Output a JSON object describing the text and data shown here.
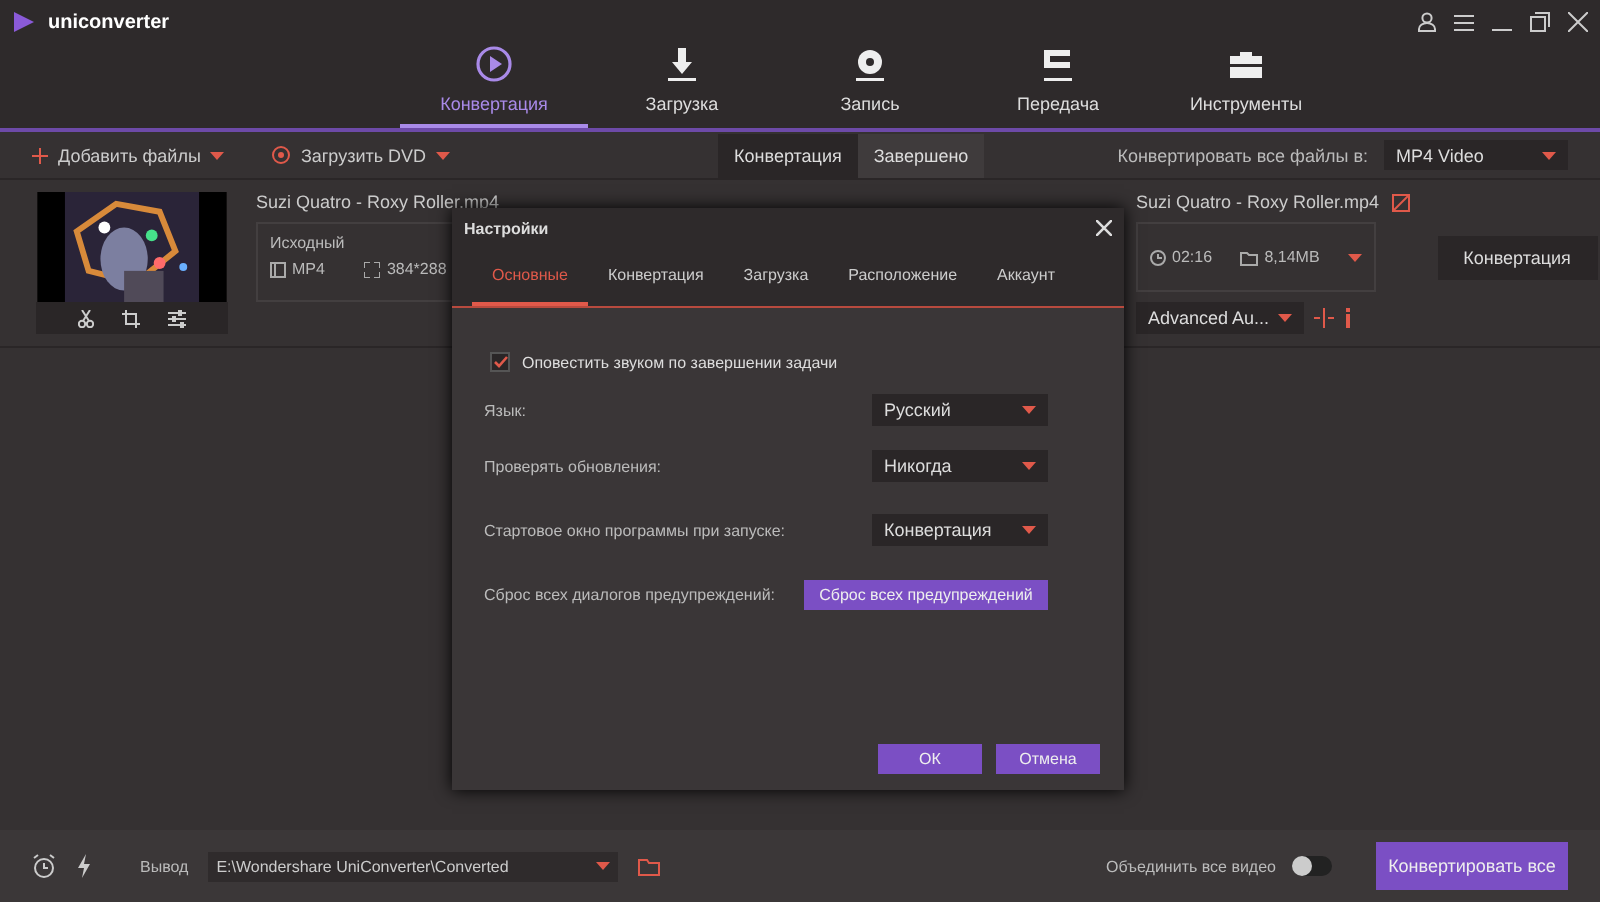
{
  "app": {
    "name": "uniconverter"
  },
  "nav": {
    "tabs": [
      {
        "label": "Конвертация",
        "selected": true
      },
      {
        "label": "Загрузка",
        "selected": false
      },
      {
        "label": "Запись",
        "selected": false
      },
      {
        "label": "Передача",
        "selected": false
      },
      {
        "label": "Инструменты",
        "selected": false
      }
    ]
  },
  "toolbar": {
    "add_files": "Добавить файлы",
    "load_dvd": "Загрузить DVD",
    "status_tabs": [
      {
        "label": "Конвертация",
        "selected": true
      },
      {
        "label": "Завершено",
        "selected": false
      }
    ],
    "convert_all_label": "Конвертировать все файлы в:",
    "format": "MP4 Video"
  },
  "file": {
    "source_title": "Suzi Quatro - Roxy Roller.mp4",
    "source": {
      "label": "Исходный",
      "format": "MP4",
      "resolution": "384*288"
    },
    "target_title": "Suzi Quatro - Roxy Roller.mp4",
    "target": {
      "duration": "02:16",
      "size": "8,14MB",
      "audio": "Advanced Au..."
    },
    "convert_button": "Конвертация"
  },
  "dialog": {
    "title": "Настройки",
    "tabs": [
      {
        "label": "Основные",
        "selected": true
      },
      {
        "label": "Конвертация",
        "selected": false
      },
      {
        "label": "Загрузка",
        "selected": false
      },
      {
        "label": "Расположение",
        "selected": false
      },
      {
        "label": "Аккаунт",
        "selected": false
      }
    ],
    "notify": {
      "label": "Оповестить звуком по завершении задачи",
      "checked": true
    },
    "settings": [
      {
        "kind": "select",
        "label": "Язык:",
        "value": "Русский"
      },
      {
        "kind": "select",
        "label": "Проверять обновления:",
        "value": "Никогда"
      },
      {
        "kind": "select",
        "label": "Стартовое окно программы при запуске:",
        "value": "Конвертация"
      },
      {
        "kind": "button",
        "label": "Сброс всех диалогов предупреждений:",
        "value": "Сброс всех предупреждений"
      }
    ],
    "ok": "ОК",
    "cancel": "Отмена"
  },
  "bottom": {
    "output_label": "Вывод",
    "output_path": "E:\\Wondershare UniConverter\\Converted",
    "merge_label": "Объединить все видео",
    "merge_on": false,
    "convert_all": "Конвертировать все"
  }
}
